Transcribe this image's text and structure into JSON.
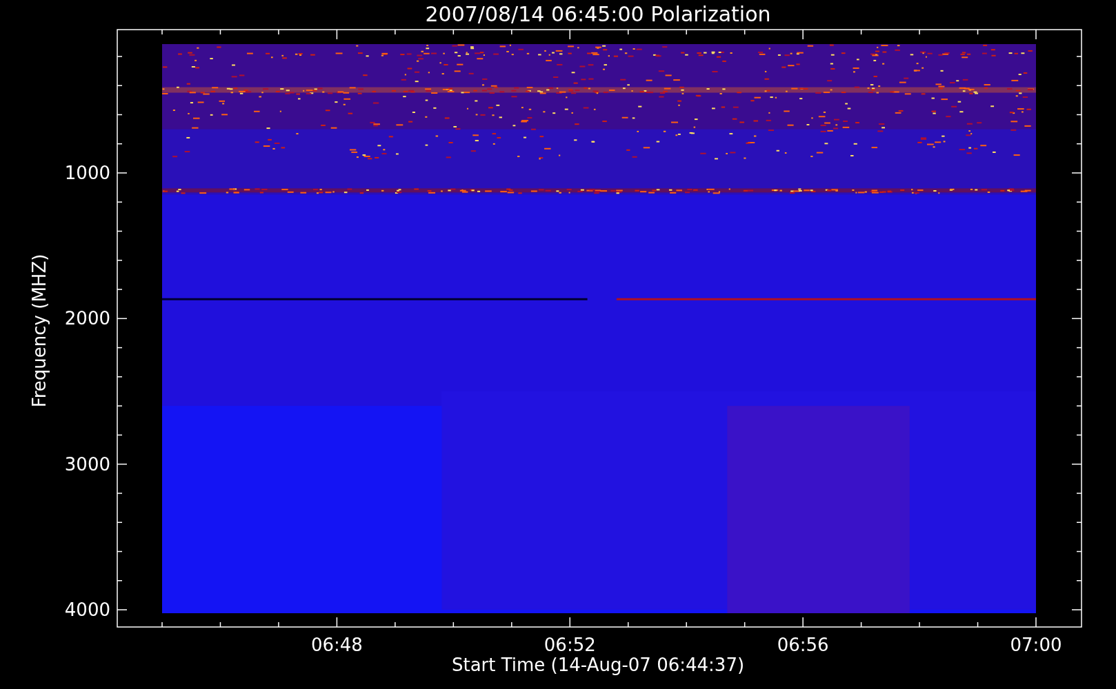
{
  "title": "2007/08/14 06:45:00 Polarization",
  "y_axis": {
    "label": "Frequency (MHZ)",
    "ticks": [
      "1000",
      "2000",
      "3000",
      "4000"
    ]
  },
  "x_axis": {
    "label": "Start Time (14-Aug-07 06:44:37)",
    "ticks": [
      "06:48",
      "06:52",
      "06:56",
      "07:00"
    ]
  }
}
